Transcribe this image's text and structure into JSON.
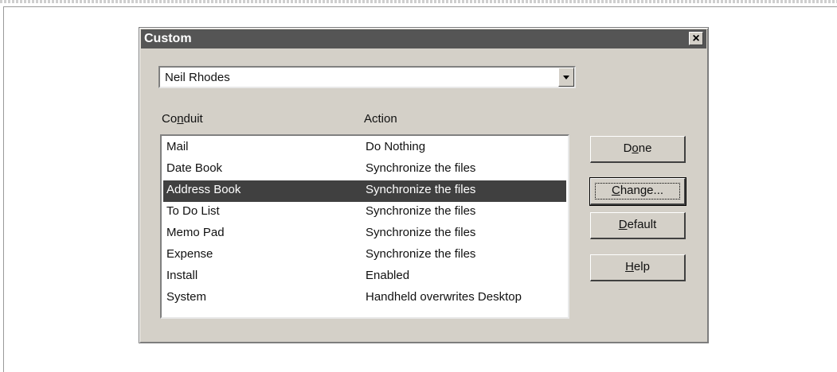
{
  "dialog": {
    "title": "Custom",
    "close_label": "×"
  },
  "user_select": {
    "value": "Neil Rhodes"
  },
  "list": {
    "columns": [
      "Conduit",
      "Action"
    ],
    "rows": [
      {
        "conduit": "Mail",
        "action": "Do Nothing",
        "selected": false
      },
      {
        "conduit": "Date Book",
        "action": "Synchronize the files",
        "selected": false
      },
      {
        "conduit": "Address Book",
        "action": "Synchronize the files",
        "selected": true
      },
      {
        "conduit": "To Do List",
        "action": "Synchronize the files",
        "selected": false
      },
      {
        "conduit": "Memo Pad",
        "action": "Synchronize the files",
        "selected": false
      },
      {
        "conduit": "Expense",
        "action": "Synchronize the files",
        "selected": false
      },
      {
        "conduit": "Install",
        "action": "Enabled",
        "selected": false
      },
      {
        "conduit": "System",
        "action": "Handheld overwrites Desktop",
        "selected": false
      }
    ]
  },
  "buttons": {
    "done": "Done",
    "change": "Change...",
    "default": "Default",
    "help": "Help"
  },
  "colors": {
    "titlebar": "#555555",
    "dialog_face": "#d4d0c8",
    "selection": "#404040"
  }
}
